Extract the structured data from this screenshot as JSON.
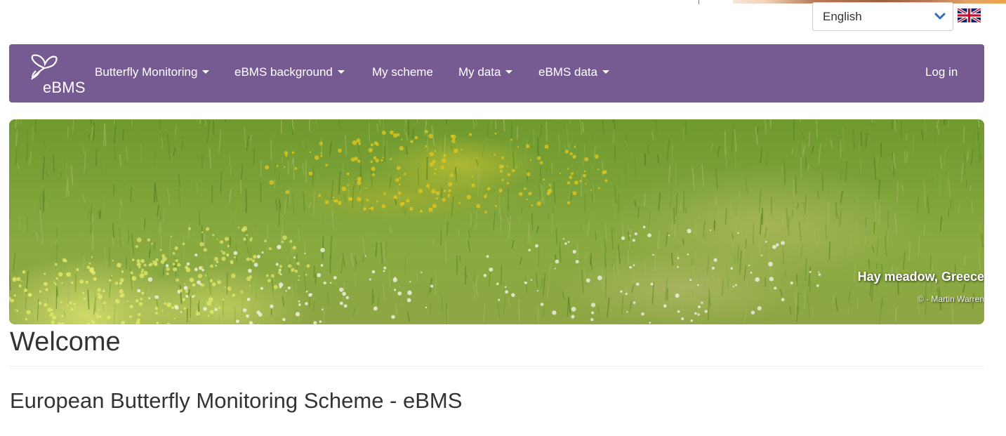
{
  "language": {
    "selected": "English",
    "flag_icon": "uk-flag-icon"
  },
  "brand": {
    "logo_text": "eBMS",
    "logo_icon": "butterfly-icon"
  },
  "nav": {
    "items": [
      {
        "label": "Butterfly Monitoring",
        "dropdown": true
      },
      {
        "label": "eBMS background",
        "dropdown": true
      },
      {
        "label": "My scheme",
        "dropdown": false
      },
      {
        "label": "My data",
        "dropdown": true
      },
      {
        "label": "eBMS data",
        "dropdown": true
      }
    ],
    "login": "Log in"
  },
  "hero": {
    "caption_title": "Hay meadow, Greece",
    "caption_credit": "© - Martin Warren"
  },
  "content": {
    "heading": "Welcome",
    "subheading": "European Butterfly Monitoring Scheme - eBMS"
  },
  "colors": {
    "navbar": "#765b92",
    "text": "#333333"
  }
}
